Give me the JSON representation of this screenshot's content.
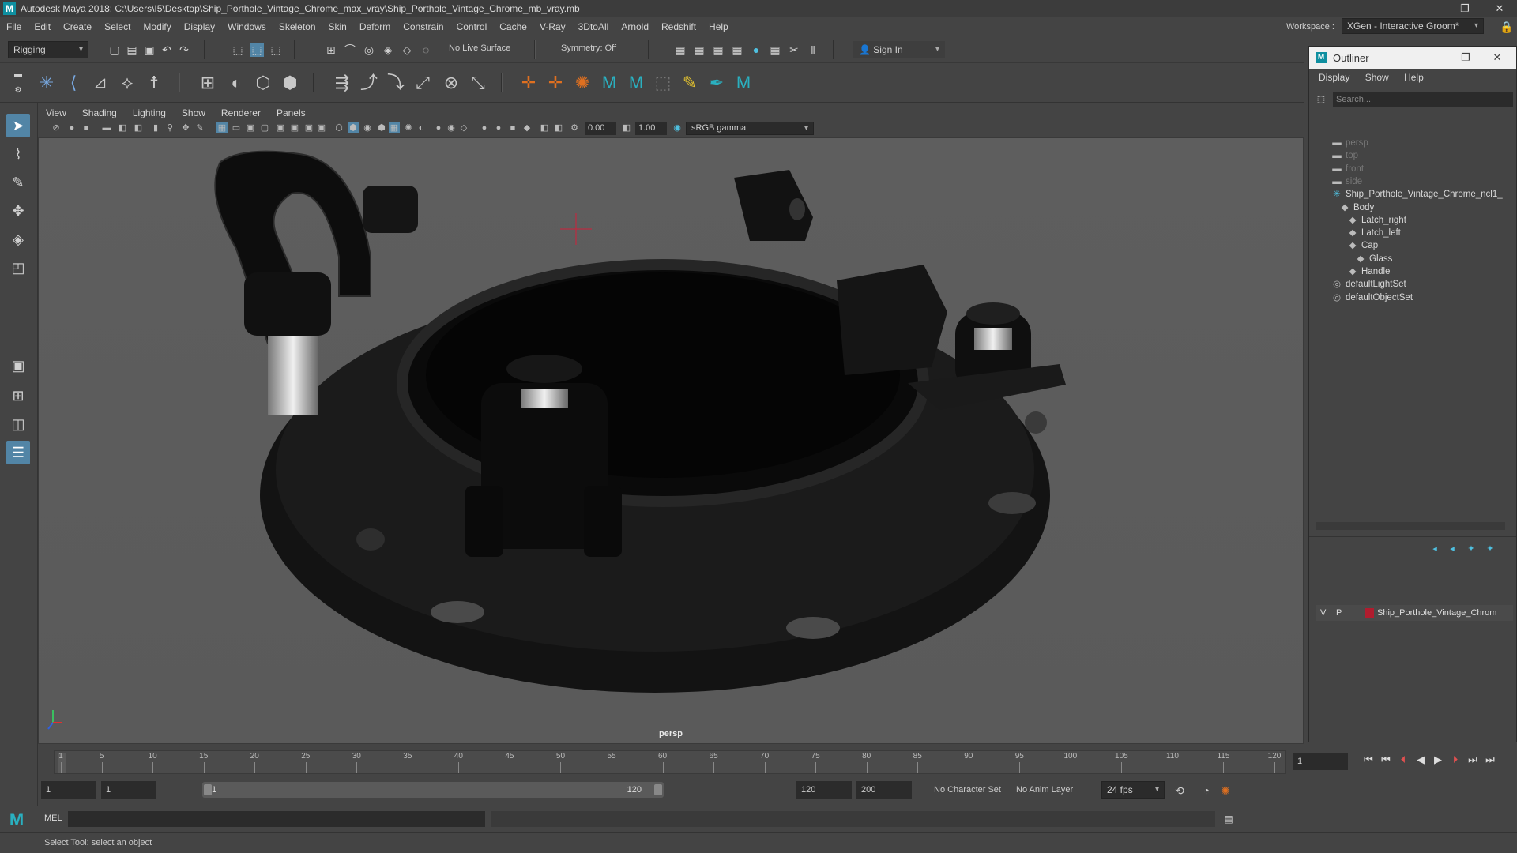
{
  "window": {
    "title": "Autodesk Maya 2018: C:\\Users\\I5\\Desktop\\Ship_Porthole_Vintage_Chrome_max_vray\\Ship_Porthole_Vintage_Chrome_mb_vray.mb",
    "controls": [
      "–",
      "❐",
      "✕"
    ]
  },
  "menubar": [
    "File",
    "Edit",
    "Create",
    "Select",
    "Modify",
    "Display",
    "Windows",
    "Skeleton",
    "Skin",
    "Deform",
    "Constrain",
    "Control",
    "Cache",
    "V-Ray",
    "3DtoAll",
    "Arnold",
    "Redshift",
    "Help"
  ],
  "workspace": {
    "label": "Workspace :",
    "value": "XGen - Interactive Groom*"
  },
  "statusline": {
    "menuset": "Rigging",
    "live_surface": "No Live Surface",
    "symmetry": "Symmetry: Off",
    "signin": "Sign In"
  },
  "panel": {
    "menus": [
      "View",
      "Shading",
      "Lighting",
      "Show",
      "Renderer",
      "Panels"
    ],
    "exposure": "0.00",
    "gamma": "1.00",
    "colorspace": "sRGB gamma",
    "camera": "persp"
  },
  "outliner": {
    "title": "Outliner",
    "menus": [
      "Display",
      "Show",
      "Help"
    ],
    "search_placeholder": "Search...",
    "items": [
      {
        "label": "persp",
        "icon": "camera-icon",
        "dim": true,
        "depth": 0
      },
      {
        "label": "top",
        "icon": "camera-icon",
        "dim": true,
        "depth": 0
      },
      {
        "label": "front",
        "icon": "camera-icon",
        "dim": true,
        "depth": 0
      },
      {
        "label": "side",
        "icon": "camera-icon",
        "dim": true,
        "depth": 0
      },
      {
        "label": "Ship_Porthole_Vintage_Chrome_ncl1_",
        "icon": "group-icon",
        "dim": false,
        "depth": 0
      },
      {
        "label": "Body",
        "icon": "mesh-icon",
        "dim": false,
        "depth": 1
      },
      {
        "label": "Latch_right",
        "icon": "mesh-icon",
        "dim": false,
        "depth": 2
      },
      {
        "label": "Latch_left",
        "icon": "mesh-icon",
        "dim": false,
        "depth": 2
      },
      {
        "label": "Cap",
        "icon": "mesh-icon",
        "dim": false,
        "depth": 2
      },
      {
        "label": "Glass",
        "icon": "mesh-icon",
        "dim": false,
        "depth": 3
      },
      {
        "label": "Handle",
        "icon": "mesh-icon",
        "dim": false,
        "depth": 2
      },
      {
        "label": "defaultLightSet",
        "icon": "set-icon",
        "dim": false,
        "depth": 0
      },
      {
        "label": "defaultObjectSet",
        "icon": "set-icon",
        "dim": false,
        "depth": 0
      }
    ],
    "layer": {
      "v": "V",
      "p": "P",
      "name": "Ship_Porthole_Vintage_Chrom",
      "color": "#b01c2e"
    }
  },
  "timeline": {
    "ticks": [
      "1",
      "5",
      "10",
      "15",
      "20",
      "25",
      "30",
      "35",
      "40",
      "45",
      "50",
      "55",
      "60",
      "65",
      "70",
      "75",
      "80",
      "85",
      "90",
      "95",
      "100",
      "105",
      "110",
      "115",
      "120"
    ],
    "current_frame": "1"
  },
  "range": {
    "start": "1",
    "playback_start": "1",
    "slider_start": "1",
    "slider_end": "120",
    "playback_end": "120",
    "end": "200",
    "character_set": "No Character Set",
    "anim_layer": "No Anim Layer",
    "fps": "24 fps"
  },
  "cmdline": {
    "label": "MEL"
  },
  "helpline": {
    "text": "Select Tool: select an object"
  },
  "colors": {
    "accent": "#5285a6",
    "maya_teal": "#0f8fa0",
    "layer_red": "#b01c2e"
  }
}
